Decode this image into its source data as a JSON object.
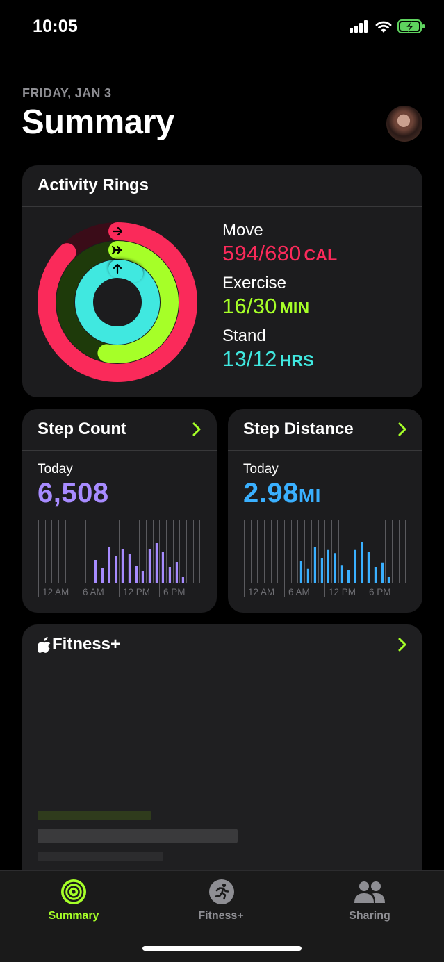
{
  "status_bar": {
    "time": "10:05"
  },
  "header": {
    "date": "FRIDAY, JAN 3",
    "title": "Summary"
  },
  "activity_rings": {
    "title": "Activity Rings",
    "move": {
      "label": "Move",
      "value": "594/680",
      "unit": "CAL",
      "color": "#fa2a5a",
      "progress": 0.874
    },
    "exercise": {
      "label": "Exercise",
      "value": "16/30",
      "unit": "MIN",
      "color": "#a6ff28",
      "progress": 0.533
    },
    "stand": {
      "label": "Stand",
      "value": "13/12",
      "unit": "HRS",
      "color": "#40e8e0",
      "progress": 1.083
    }
  },
  "step_count": {
    "title": "Step Count",
    "period": "Today",
    "value": "6,508",
    "color": "#a78bff",
    "axis_labels": [
      "12 AM",
      "6 AM",
      "12 PM",
      "6 PM"
    ]
  },
  "step_distance": {
    "title": "Step Distance",
    "period": "Today",
    "value": "2.98",
    "unit": "MI",
    "color": "#3ab0ff",
    "axis_labels": [
      "12 AM",
      "6 AM",
      "12 PM",
      "6 PM"
    ]
  },
  "fitness_plus": {
    "title": "Fitness+"
  },
  "tab_bar": {
    "tabs": [
      {
        "label": "Summary",
        "icon": "activity-rings-icon",
        "active": true
      },
      {
        "label": "Fitness+",
        "icon": "running-figure-icon",
        "active": false
      },
      {
        "label": "Sharing",
        "icon": "people-icon",
        "active": false
      }
    ],
    "active_color": "#a6ff28"
  },
  "chart_data": [
    {
      "type": "bar",
      "title": "Step Count",
      "x": [
        0,
        1,
        2,
        3,
        4,
        5,
        6,
        7,
        8,
        9,
        10,
        11,
        12,
        13,
        14,
        15,
        16,
        17,
        18,
        19,
        20,
        21,
        22,
        23
      ],
      "x_tick_labels": [
        "12 AM",
        "6 AM",
        "12 PM",
        "6 PM"
      ],
      "values": [
        0,
        0,
        0,
        0,
        0,
        0,
        0,
        0,
        330,
        210,
        510,
        380,
        480,
        420,
        240,
        170,
        480,
        570,
        440,
        230,
        300,
        90,
        0,
        0
      ],
      "ylim": [
        0,
        900
      ]
    },
    {
      "type": "bar",
      "title": "Step Distance",
      "x": [
        0,
        1,
        2,
        3,
        4,
        5,
        6,
        7,
        8,
        9,
        10,
        11,
        12,
        13,
        14,
        15,
        16,
        17,
        18,
        19,
        20,
        21,
        22,
        23
      ],
      "x_tick_labels": [
        "12 AM",
        "6 AM",
        "12 PM",
        "6 PM"
      ],
      "values": [
        0,
        0,
        0,
        0,
        0,
        0,
        0,
        0,
        0.14,
        0.09,
        0.23,
        0.16,
        0.21,
        0.19,
        0.11,
        0.08,
        0.21,
        0.26,
        0.2,
        0.1,
        0.13,
        0.04,
        0,
        0
      ],
      "ylim": [
        0,
        0.4
      ]
    }
  ]
}
